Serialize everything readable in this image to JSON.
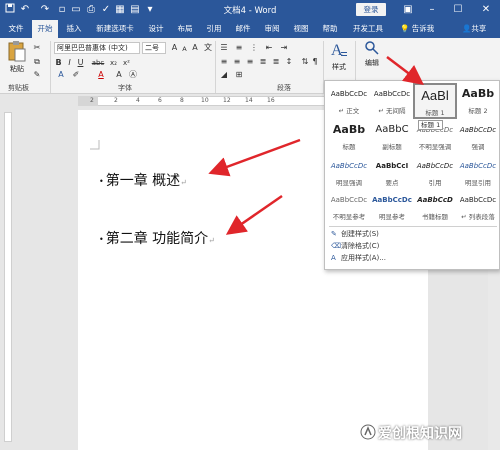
{
  "titlebar": {
    "doc_title": "文档4 - Word",
    "login": "登录",
    "icons": [
      "save-icon",
      "undo-icon",
      "redo-icon",
      "new-doc-icon",
      "open-icon",
      "print-preview-icon",
      "spelling-icon",
      "table-icon",
      "customize-icon"
    ]
  },
  "tabs": [
    "文件",
    "开始",
    "插入",
    "新建选项卡",
    "设计",
    "布局",
    "引用",
    "邮件",
    "审阅",
    "视图",
    "帮助",
    "开发工具"
  ],
  "active_tab": "开始",
  "tell_me": "告诉我",
  "share": "共享",
  "ribbon": {
    "paste": "粘贴",
    "clipboard": "剪贴板",
    "font_name": "阿里巴巴普惠体 (中文)",
    "font_size": "二号",
    "font_group": "字体",
    "paragraph_group": "段落",
    "styles_btn": "样式",
    "styles_group": "样式",
    "editing_btn": "编辑",
    "btn_bold": "B",
    "btn_italic": "I",
    "btn_underline": "U",
    "btn_strike": "abc",
    "btn_subscript": "x₂",
    "btn_superscript": "x²",
    "btn_font_color": "A",
    "btn_highlight": "A",
    "btn_grow": "A",
    "btn_shrink": "A",
    "btn_clear": "A",
    "btn_wen": "文"
  },
  "ruler": {
    "numbers": [
      "2",
      "2",
      "4",
      "6",
      "8",
      "10",
      "12",
      "14",
      "16"
    ]
  },
  "document": {
    "headings": [
      "第一章 概述",
      "第二章 功能简介"
    ]
  },
  "gallery": {
    "styles": [
      {
        "sample": "AaBbCcDc",
        "name": "↵ 正文"
      },
      {
        "sample": "AaBbCcDc",
        "name": "↵ 无间隔"
      },
      {
        "sample": "AaBl",
        "name": "标题 1"
      },
      {
        "sample": "AaBb",
        "name": "标题 2"
      },
      {
        "sample": "AaBb",
        "name": "标题"
      },
      {
        "sample": "AaBbC",
        "name": "副标题"
      },
      {
        "sample": "AaBbCcDc",
        "name": "不明显强调"
      },
      {
        "sample": "AaBbCcDc",
        "name": "强调"
      },
      {
        "sample": "AaBbCcDc",
        "name": "明显强调"
      },
      {
        "sample": "AaBbCcI",
        "name": "要点"
      },
      {
        "sample": "AaBbCcDc",
        "name": "引用"
      },
      {
        "sample": "AaBbCcDc",
        "name": "明显引用"
      },
      {
        "sample": "AaBbCcDc",
        "name": "不明显参考"
      },
      {
        "sample": "AaBbCcDc",
        "name": "明显参考"
      },
      {
        "sample": "AaBbCcD",
        "name": "书籍标题"
      },
      {
        "sample": "AaBbCcDc",
        "name": "↵ 列表段落"
      }
    ],
    "selected_style": "标题 1",
    "tooltip": "标题 1",
    "menu": [
      "创建样式(S)",
      "清除格式(C)",
      "应用样式(A)..."
    ]
  },
  "watermark": "爱创根知识网",
  "colors": {
    "brand_blue": "#2b579a",
    "arrow_red": "#e0262b"
  }
}
